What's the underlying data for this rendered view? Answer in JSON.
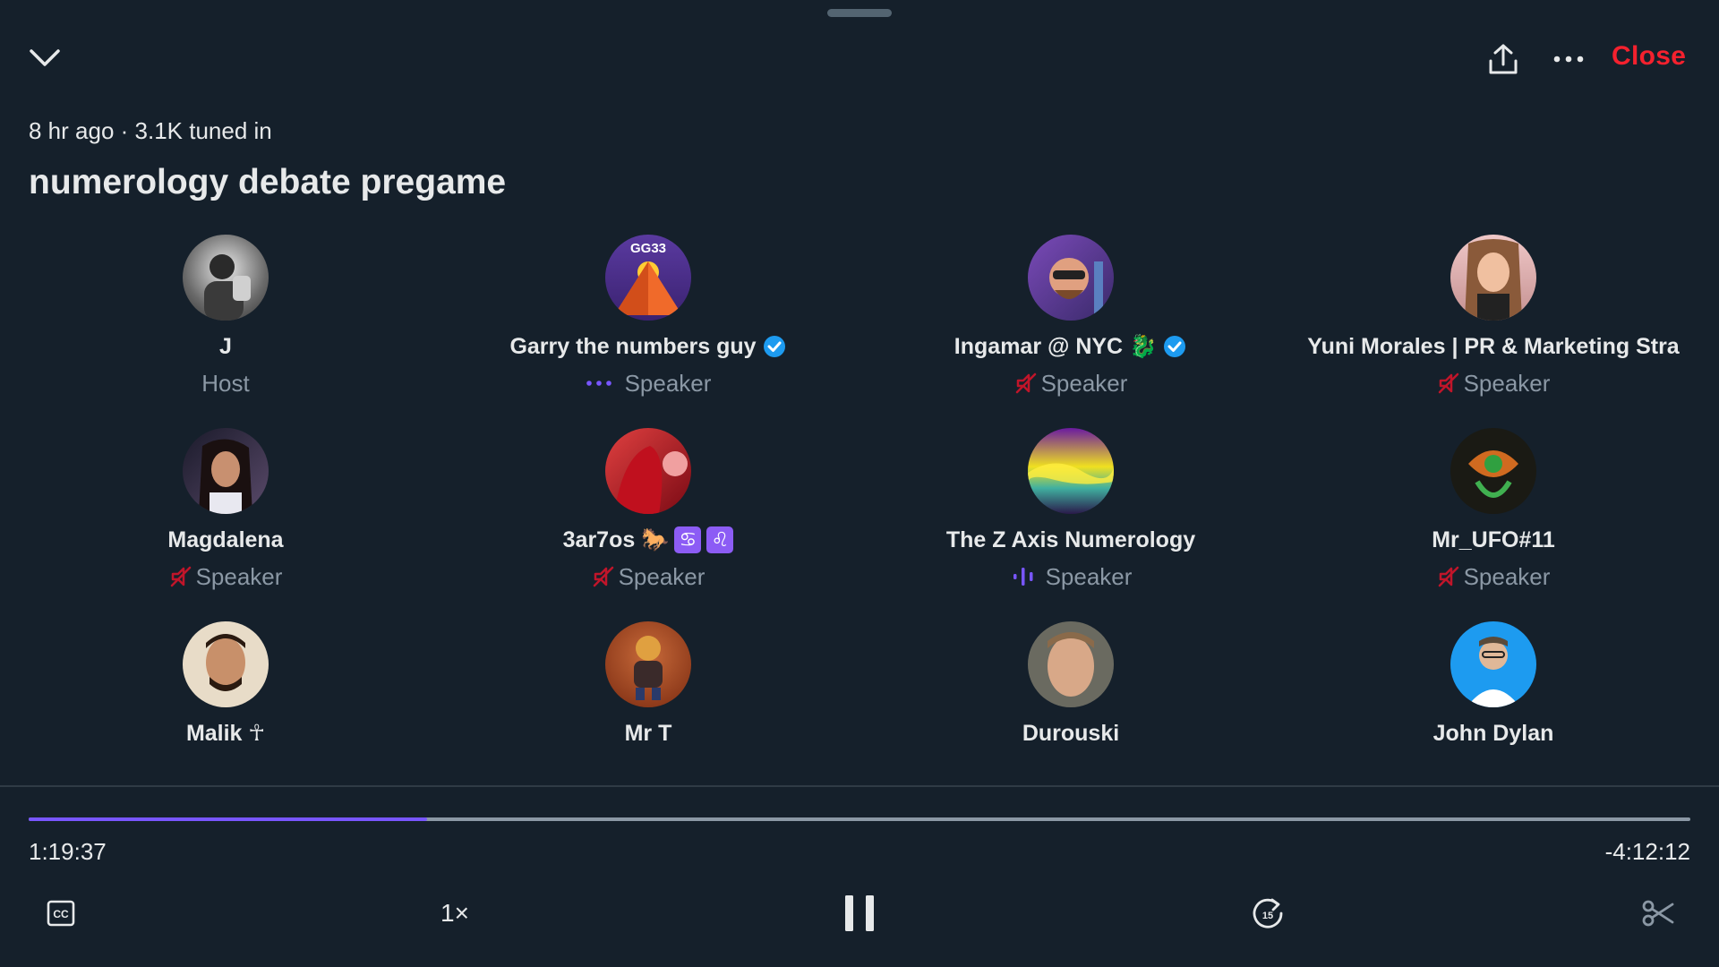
{
  "header": {
    "close_label": "Close",
    "meta_text": "8 hr ago · 3.1K tuned in",
    "title": "numerology debate pregame"
  },
  "participants": [
    {
      "name": "J",
      "role": "Host",
      "status": "none",
      "avatar_color": "#9aa0a6"
    },
    {
      "name": "Garry the numbers guy",
      "role": "Speaker",
      "status": "dots",
      "verified": true,
      "avatar_color": "#4b2e83",
      "avatar_text": "GG33"
    },
    {
      "name": "Ingamar @ NYC 🐉",
      "role": "Speaker",
      "status": "muted",
      "verified": true,
      "avatar_color": "#5a3b8c"
    },
    {
      "name": "Yuni Morales | PR & Marketing Stra",
      "role": "Speaker",
      "status": "muted",
      "avatar_color": "#d8a1a8"
    },
    {
      "name": "Magdalena",
      "role": "Speaker",
      "status": "muted",
      "avatar_color": "#3a2a2a"
    },
    {
      "name": "3ar7os 🐎",
      "role": "Speaker",
      "status": "muted",
      "badges": [
        "♋",
        "♌"
      ],
      "avatar_color": "#b3121f"
    },
    {
      "name": "The Z Axis Numerology",
      "role": "Speaker",
      "status": "speaking",
      "avatar_color": "#c9b400"
    },
    {
      "name": "Mr_UFO#11",
      "role": "Speaker",
      "status": "muted",
      "avatar_color": "#2a3a2a"
    },
    {
      "name": "Malik ☥",
      "role": "",
      "status": "none",
      "avatar_color": "#c9a98a"
    },
    {
      "name": "Mr T",
      "role": "",
      "status": "none",
      "avatar_color": "#a0522d"
    },
    {
      "name": "Durouski",
      "role": "",
      "status": "none",
      "avatar_color": "#8a7a6a"
    },
    {
      "name": "John Dylan",
      "role": "",
      "status": "none",
      "avatar_color": "#1d9bf0"
    }
  ],
  "player": {
    "elapsed": "1:19:37",
    "remaining": "-4:12:12",
    "progress_fraction": 0.24,
    "speed_label": "1×"
  },
  "colors": {
    "background": "#15202b",
    "accent": "#7856ff",
    "close": "#f4212e",
    "muted_icon": "#c0152a",
    "verified": "#1d9bf0"
  }
}
